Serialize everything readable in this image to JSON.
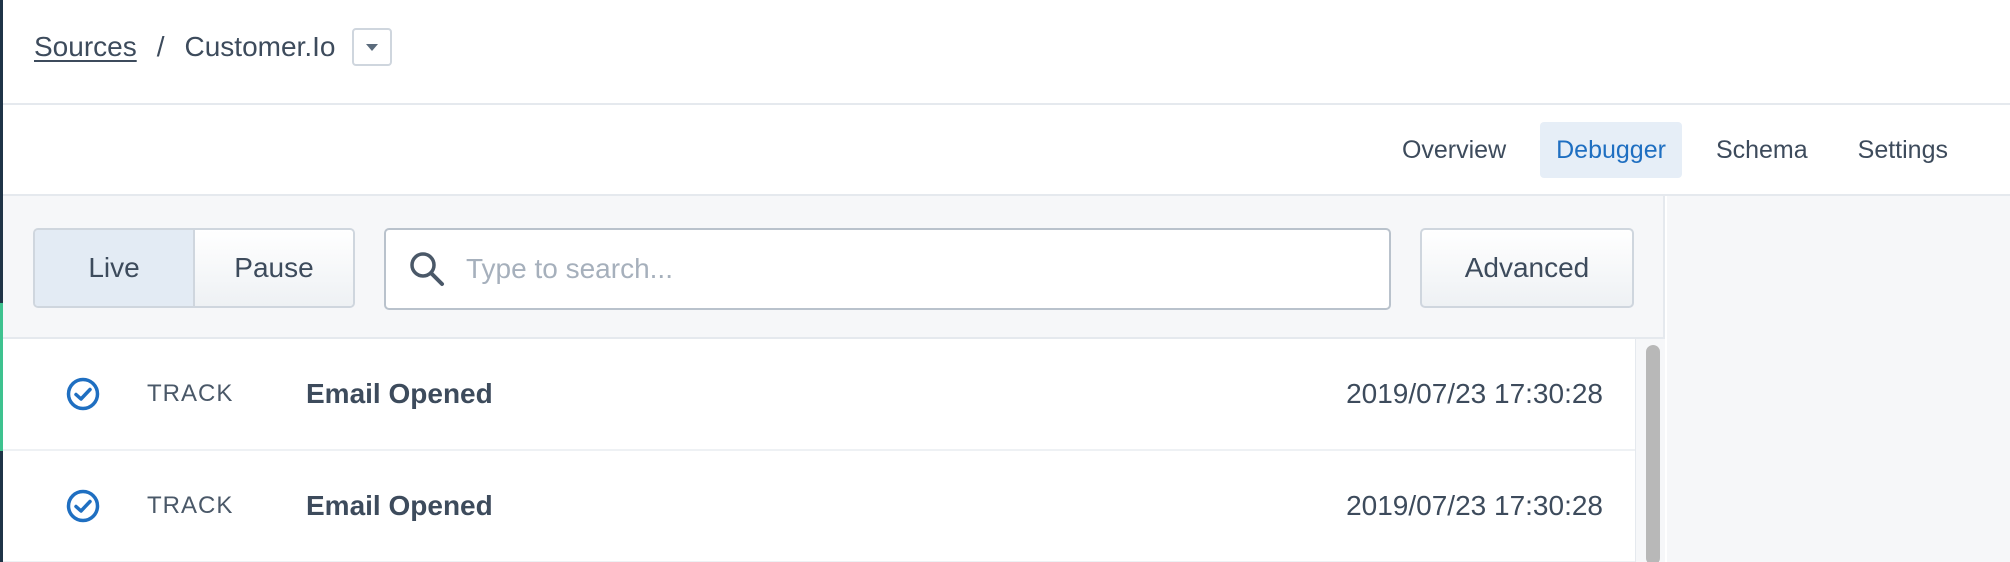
{
  "breadcrumb": {
    "parent_label": "Sources",
    "separator": "/",
    "current_label": "Customer.Io"
  },
  "tabs": [
    {
      "label": "Overview",
      "active": false
    },
    {
      "label": "Debugger",
      "active": true
    },
    {
      "label": "Schema",
      "active": false
    },
    {
      "label": "Settings",
      "active": false
    }
  ],
  "toolbar": {
    "live_label": "Live",
    "pause_label": "Pause",
    "search_placeholder": "Type to search...",
    "search_value": "",
    "advanced_label": "Advanced"
  },
  "events": [
    {
      "icon": "check-circle-icon",
      "type": "TRACK",
      "name": "Email Opened",
      "timestamp": "2019/07/23 17:30:28"
    },
    {
      "icon": "check-circle-icon",
      "type": "TRACK",
      "name": "Email Opened",
      "timestamp": "2019/07/23 17:30:28"
    }
  ],
  "colors": {
    "accent": "#1f6fc1",
    "active_tab_bg": "#e6eef7",
    "live_indicator": "#3ec28f",
    "nav_dark": "#1f3447"
  }
}
